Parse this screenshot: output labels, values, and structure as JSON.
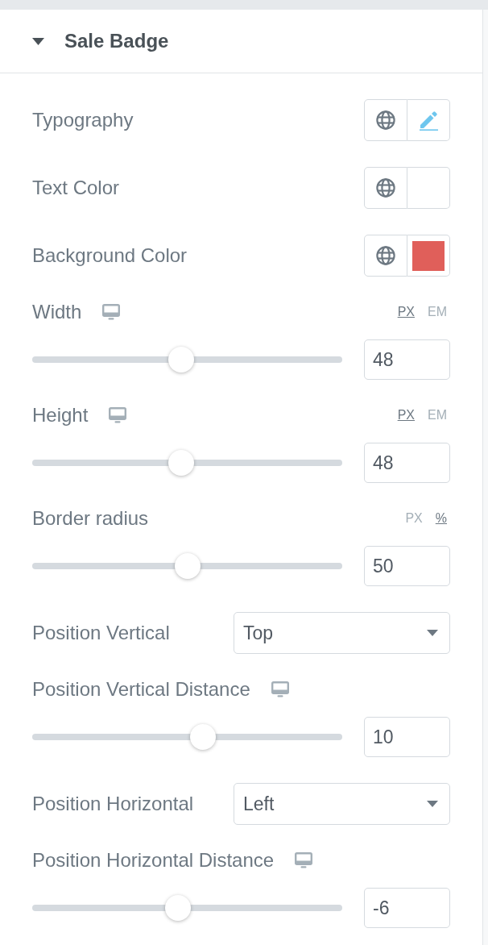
{
  "section": {
    "title": "Sale Badge",
    "expanded": true
  },
  "controls": [
    {
      "kind": "popover",
      "label": "Typography"
    },
    {
      "kind": "color",
      "label": "Text Color"
    },
    {
      "kind": "color",
      "label": "Background Color",
      "color": "#e05f5a"
    },
    {
      "kind": "slider",
      "label": "Width",
      "responsive": true,
      "units": [
        {
          "label": "PX",
          "selected": true
        },
        {
          "label": "EM",
          "selected": false
        }
      ],
      "level": 0.48,
      "value": "48"
    },
    {
      "kind": "slider",
      "label": "Height",
      "responsive": true,
      "units": [
        {
          "label": "PX",
          "selected": true
        },
        {
          "label": "EM",
          "selected": false
        }
      ],
      "level": 0.48,
      "value": "48"
    },
    {
      "kind": "slider",
      "label": "Border radius",
      "responsive": false,
      "units": [
        {
          "label": "PX",
          "selected": false
        },
        {
          "label": "%",
          "selected": true
        }
      ],
      "level": 0.5,
      "value": "50"
    },
    {
      "kind": "select",
      "label": "Position Vertical",
      "value": "Top"
    },
    {
      "kind": "slider",
      "label": "Position Vertical Distance",
      "responsive": true,
      "level": 0.55,
      "value": "10"
    },
    {
      "kind": "select",
      "label": "Position Horizontal",
      "value": "Left"
    },
    {
      "kind": "slider",
      "label": "Position Horizontal Distance",
      "responsive": true,
      "level": 0.47,
      "value": "-6"
    }
  ]
}
